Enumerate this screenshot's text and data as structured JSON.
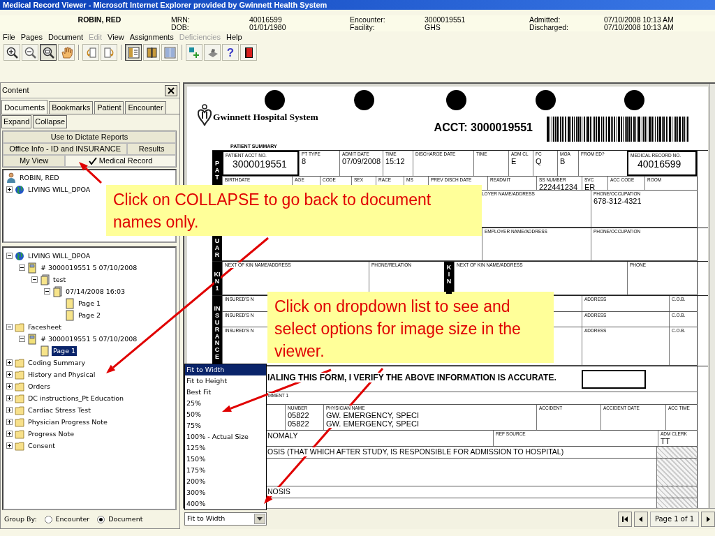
{
  "window": {
    "title": "Medical Record Viewer - Microsoft Internet Explorer provided by Gwinnett Health System"
  },
  "patient_header": {
    "name": "ROBIN, RED",
    "fields": [
      {
        "label": "MRN:",
        "value": "40016599"
      },
      {
        "label": "DOB:",
        "value": "01/01/1980"
      },
      {
        "label": "Encounter:",
        "value": "3000019551"
      },
      {
        "label": "Facility:",
        "value": "GHS"
      },
      {
        "label": "Admitted:",
        "value": "07/10/2008 10:13 AM"
      },
      {
        "label": "Discharged:",
        "value": "07/10/2008 10:13 AM"
      }
    ]
  },
  "menu": [
    {
      "label": "File",
      "disabled": false
    },
    {
      "label": "Pages",
      "disabled": false
    },
    {
      "label": "Document",
      "disabled": false
    },
    {
      "label": "Edit",
      "disabled": true
    },
    {
      "label": "View",
      "disabled": false
    },
    {
      "label": "Assignments",
      "disabled": false
    },
    {
      "label": "Deficiencies",
      "disabled": true
    },
    {
      "label": "Help",
      "disabled": false
    }
  ],
  "toolbar": [
    [
      {
        "kind": "zoom_in",
        "pressed": false
      },
      {
        "kind": "zoom_out",
        "pressed": false
      },
      {
        "kind": "zoom_area",
        "pressed": true
      },
      {
        "kind": "pan",
        "pressed": false
      }
    ],
    [
      {
        "kind": "rotate_left",
        "pressed": false
      },
      {
        "kind": "rotate_right",
        "pressed": false
      }
    ],
    [
      {
        "kind": "panel",
        "pressed": true
      },
      {
        "kind": "book",
        "pressed": false
      },
      {
        "kind": "columns",
        "pressed": false
      }
    ],
    [
      {
        "kind": "add",
        "pressed": false
      },
      {
        "kind": "stamp",
        "pressed": false
      },
      {
        "kind": "help",
        "pressed": false,
        "glyph": "?"
      },
      {
        "kind": "exit",
        "pressed": false
      }
    ]
  ],
  "content_panel": {
    "title": "Content",
    "tabs": [
      {
        "label": "Documents",
        "selected": true
      },
      {
        "label": "Bookmarks",
        "selected": false
      },
      {
        "label": "Patient",
        "selected": false
      },
      {
        "label": "Encounter",
        "selected": false
      }
    ],
    "buttons": [
      "Expand",
      "Collapse"
    ],
    "view_tabs": [
      [
        {
          "label": "Use to Dictate Reports",
          "selected": false
        }
      ],
      [
        {
          "label": "Office Info - ID and INSURANCE",
          "selected": false
        },
        {
          "label": "Results",
          "selected": false
        }
      ],
      [
        {
          "label": "My View",
          "selected": false
        },
        {
          "label": "Medical Record",
          "selected": true
        }
      ]
    ],
    "patient_tree": [
      {
        "kind": "person",
        "label": "ROBIN, RED",
        "selected": false,
        "children": [
          {
            "kind": "globe",
            "label": "LIVING WILL_DPOA",
            "expanded": false,
            "selected": false
          }
        ]
      }
    ],
    "document_tree": [
      {
        "kind": "globe",
        "label": "LIVING WILL_DPOA",
        "expanded": true,
        "selected": false,
        "children": [
          {
            "kind": "encounter",
            "label": "# 3000019551  5  07/10/2008",
            "expanded": true,
            "selected": false,
            "children": [
              {
                "kind": "note",
                "label": "test",
                "expanded": true,
                "selected": false,
                "children": [
                  {
                    "kind": "note",
                    "label": "07/14/2008 16:03",
                    "expanded": true,
                    "selected": false,
                    "children": [
                      {
                        "kind": "page",
                        "label": "Page 1",
                        "selected": false
                      },
                      {
                        "kind": "page",
                        "label": "Page 2",
                        "selected": false
                      }
                    ]
                  }
                ]
              }
            ]
          }
        ]
      },
      {
        "kind": "folder",
        "label": "Facesheet",
        "expanded": true,
        "selected": false,
        "children": [
          {
            "kind": "encounter",
            "label": "# 3000019551  5  07/10/2008",
            "expanded": true,
            "selected": false,
            "children": [
              {
                "kind": "page",
                "label": "Page 1",
                "selected": true
              }
            ]
          }
        ]
      },
      {
        "kind": "folder",
        "label": "Coding Summary",
        "expanded": false,
        "selected": false
      },
      {
        "kind": "folder",
        "label": "History and Physical",
        "expanded": false,
        "selected": false
      },
      {
        "kind": "folder",
        "label": "Orders",
        "expanded": false,
        "selected": false
      },
      {
        "kind": "folder",
        "label": "DC instructions_Pt Education",
        "expanded": false,
        "selected": false
      },
      {
        "kind": "folder",
        "label": "Cardiac Stress Test",
        "expanded": false,
        "selected": false
      },
      {
        "kind": "folder",
        "label": "Physician Progress Note",
        "expanded": false,
        "selected": false
      },
      {
        "kind": "folder",
        "label": "Progress Note",
        "expanded": false,
        "selected": false
      },
      {
        "kind": "folder",
        "label": "Consent",
        "expanded": false,
        "selected": false
      }
    ],
    "group_by": {
      "label": "Group By:",
      "options": [
        {
          "label": "Encounter",
          "selected": false
        },
        {
          "label": "Document",
          "selected": true
        }
      ]
    }
  },
  "viewer": {
    "document": {
      "hospital_name": "Gwinnett Hospital System",
      "account": "ACCT: 3000019551",
      "summary_title": "PATIENT SUMMARY",
      "sections": [
        {
          "side_label": "PAT",
          "lines": [
            {
              "cells": [
                {
                  "kind": "boxed",
                  "label": "PATIENT ACCT NO.",
                  "values": [
                    "3000019551"
                  ]
                },
                {
                  "kind": "field",
                  "label": "PT TYPE",
                  "values": [
                    "8"
                  ]
                },
                {
                  "kind": "field",
                  "label": "ADMIT DATE",
                  "values": [
                    "07/09/2008"
                  ]
                },
                {
                  "kind": "field",
                  "label": "TIME",
                  "values": [
                    "15:12"
                  ]
                },
                {
                  "kind": "field",
                  "label": "DISCHARGE DATE"
                },
                {
                  "kind": "field",
                  "label": "TIME"
                },
                {
                  "kind": "field",
                  "label": "ADM CL",
                  "values": [
                    "E"
                  ]
                },
                {
                  "kind": "field",
                  "label": "FC",
                  "values": [
                    "Q"
                  ]
                },
                {
                  "kind": "field",
                  "label": "MOA",
                  "values": [
                    "B"
                  ]
                },
                {
                  "kind": "field",
                  "label": "FROM ED?"
                },
                {
                  "kind": "boxed",
                  "label": "MEDICAL RECORD NO.",
                  "values": [
                    "40016599"
                  ]
                }
              ]
            },
            {
              "cells": [
                {
                  "kind": "field",
                  "label": "BIRTHDATE"
                },
                {
                  "kind": "field",
                  "label": "AGE"
                },
                {
                  "kind": "field",
                  "label": "CODE"
                },
                {
                  "kind": "field",
                  "label": "SEX"
                },
                {
                  "kind": "field",
                  "label": "RACE"
                },
                {
                  "kind": "field",
                  "label": "MS"
                },
                {
                  "kind": "field",
                  "label": "PREV DISCH DATE"
                },
                {
                  "kind": "field",
                  "label": "READMIT"
                },
                {
                  "kind": "field",
                  "label": "SS NUMBER",
                  "values": [
                    "222441234"
                  ]
                },
                {
                  "kind": "field",
                  "label": "SVC",
                  "values": [
                    "ER"
                  ]
                },
                {
                  "kind": "field",
                  "label": "ACC CODE"
                },
                {
                  "kind": "field",
                  "label": "ROOM"
                }
              ]
            },
            {
              "cells": [
                {
                  "kind": "field",
                  "label": "LOYER NAME/ADDRESS"
                },
                {
                  "kind": "field",
                  "label": "PHONE/OCCUPATION",
                  "values": [
                    "678-312-4321"
                  ]
                }
              ]
            }
          ]
        },
        {
          "side_label": "UAR",
          "lines": [
            {
              "cells": [
                {
                  "kind": "field",
                  "label": "EMPLOYER NAME/ADDRESS"
                },
                {
                  "kind": "field",
                  "label": "PHONE/OCCUPATION"
                }
              ]
            }
          ]
        },
        {
          "side_label": "KIN1",
          "lines": [
            {
              "cells": [
                {
                  "kind": "field",
                  "label": "NEXT OF KIN NAME/ADDRESS"
                },
                {
                  "kind": "field",
                  "label": "PHONE/RELATION"
                },
                {
                  "kind": "side",
                  "label": "KIN"
                },
                {
                  "kind": "field",
                  "label": "NEXT OF KIN NAME/ADDRESS"
                },
                {
                  "kind": "field",
                  "label": "PHONE"
                }
              ]
            }
          ]
        },
        {
          "side_label": "INSURANCE",
          "lines": [
            {
              "cells": [
                {
                  "kind": "field",
                  "label": "INSURED'S N"
                },
                {
                  "kind": "field",
                  "label": "ADDRESS"
                },
                {
                  "kind": "field",
                  "label": "C.O.B."
                }
              ]
            },
            {
              "cells": [
                {
                  "kind": "field",
                  "label": "INSURED'S N"
                },
                {
                  "kind": "field",
                  "label": "ADDRESS"
                },
                {
                  "kind": "field",
                  "label": "C.O.B."
                }
              ]
            },
            {
              "cells": [
                {
                  "kind": "field",
                  "label": "INSURED'S N"
                },
                {
                  "kind": "field",
                  "label": "ADDRESS"
                },
                {
                  "kind": "field",
                  "label": "C.O.B."
                }
              ]
            }
          ]
        },
        {
          "lines": [
            {
              "cells": [
                {
                  "kind": "statement",
                  "label": "IALING THIS FORM, I VERIFY THE ABOVE INFORMATION IS ACCURATE."
                }
              ]
            },
            {
              "cells": [
                {
                  "kind": "field",
                  "label": "MMENT 1"
                }
              ]
            },
            {
              "cells": [
                {
                  "kind": "field",
                  "label": "NUMBER",
                  "values": [
                    "05822",
                    "05822"
                  ]
                },
                {
                  "kind": "field",
                  "label": "PHYSICIAN NAME",
                  "values": [
                    "GW. EMERGENCY, SPECI",
                    "GW. EMERGENCY, SPECI"
                  ]
                },
                {
                  "kind": "field",
                  "label": "ACCIDENT"
                },
                {
                  "kind": "field",
                  "label": "ACCIDENT DATE"
                },
                {
                  "kind": "field",
                  "label": "ACC TIME"
                }
              ]
            },
            {
              "cells": [
                {
                  "kind": "text",
                  "label": "NOMALY"
                },
                {
                  "kind": "field",
                  "label": "REF SOURCE"
                },
                {
                  "kind": "field",
                  "label": "ADM CLERK",
                  "values": [
                    "TT"
                  ]
                }
              ]
            },
            {
              "cells": [
                {
                  "kind": "text",
                  "label": "OSIS (THAT WHICH AFTER STUDY, IS RESPONSIBLE FOR ADMISSION TO HOSPITAL)"
                }
              ]
            },
            {
              "cells": [
                {
                  "kind": "text",
                  "label": "NOSIS"
                }
              ]
            }
          ]
        }
      ]
    },
    "zoom": {
      "value": "Fit to Width",
      "open": true,
      "options": [
        {
          "label": "Fit to Width",
          "selected": true
        },
        {
          "label": "Fit to Height",
          "selected": false
        },
        {
          "label": "Best Fit",
          "selected": false
        },
        {
          "label": "25%",
          "selected": false
        },
        {
          "label": "50%",
          "selected": false
        },
        {
          "label": "75%",
          "selected": false
        },
        {
          "label": "100% - Actual Size",
          "selected": false
        },
        {
          "label": "125%",
          "selected": false
        },
        {
          "label": "150%",
          "selected": false
        },
        {
          "label": "175%",
          "selected": false
        },
        {
          "label": "200%",
          "selected": false
        },
        {
          "label": "300%",
          "selected": false
        },
        {
          "label": "400%",
          "selected": false
        }
      ]
    },
    "page_label": "Page 1 of 1"
  },
  "callouts": [
    {
      "text": "Click on COLLAPSE to go back to document names only."
    },
    {
      "text": "Click on dropdown list to see and select options for image size in the viewer."
    }
  ]
}
